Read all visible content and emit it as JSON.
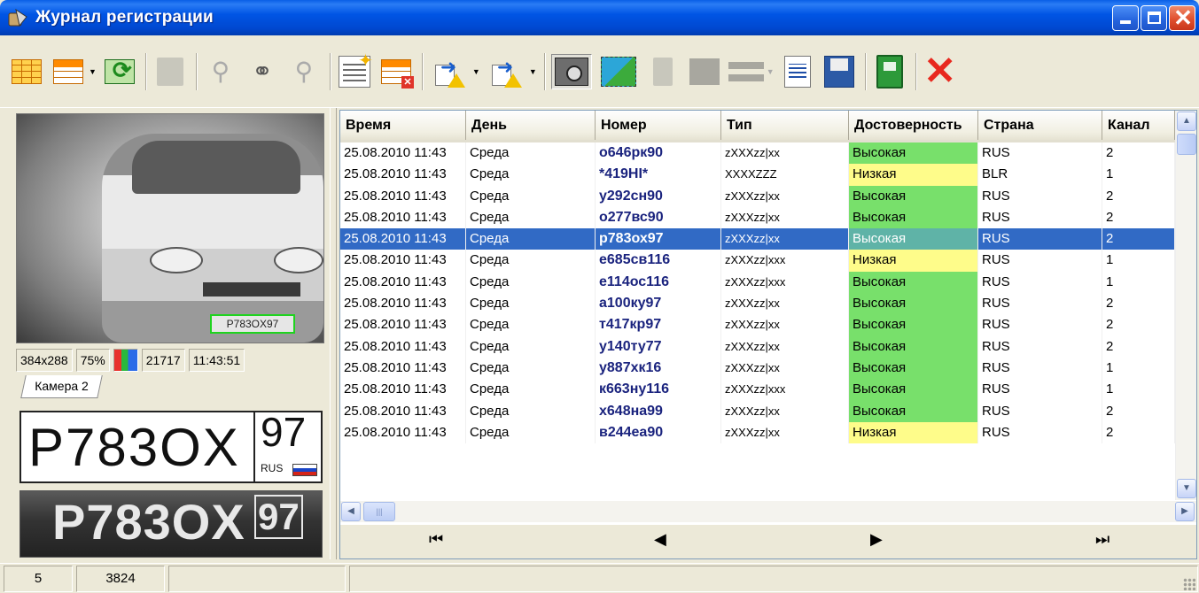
{
  "window": {
    "title": "Журнал регистрации",
    "icons": {
      "app": "app-icon",
      "minimize": "minimize-icon",
      "maximize": "maximize-icon",
      "close": "close-icon"
    }
  },
  "toolbar": {
    "buttons": [
      "table-icon",
      "table-dropdown-icon",
      "refresh-table-icon",
      "flag-icon",
      "binoculars-prev-icon",
      "binoculars-icon",
      "binoculars-next-icon",
      "table-wand-icon",
      "table-delete-icon",
      "export-icon",
      "import-icon",
      "camera-icon",
      "photo-add-icon",
      "sheet-icon",
      "rect-icon",
      "lines-icon",
      "document-icon",
      "save-icon",
      "book-icon",
      "delete-icon"
    ]
  },
  "left_panel": {
    "image_size": "384x288",
    "zoom": "75%",
    "frame": "21717",
    "time": "11:43:51",
    "camera_tab": "Камера 2",
    "plate_main": "P783OX",
    "plate_region": "97",
    "plate_country": "RUS",
    "photo_plate": "P783OX",
    "photo_region": "97",
    "overlay_plate": "P783OX97"
  },
  "grid": {
    "columns": [
      "Время",
      "День",
      "Номер",
      "Тип",
      "Достоверность",
      "Страна",
      "Канал"
    ],
    "rows": [
      {
        "time": "25.08.2010 11:43",
        "day": "Среда",
        "number": "о646рк90",
        "type": "zXXXzz|xx",
        "conf": "Высокая",
        "conf_level": "hi",
        "country": "RUS",
        "channel": "2"
      },
      {
        "time": "25.08.2010 11:43",
        "day": "Среда",
        "number": "*419HI*",
        "type": "XXXXZZZ",
        "conf": "Низкая",
        "conf_level": "lo",
        "country": "BLR",
        "channel": "1"
      },
      {
        "time": "25.08.2010 11:43",
        "day": "Среда",
        "number": "у292сн90",
        "type": "zXXXzz|xx",
        "conf": "Высокая",
        "conf_level": "hi",
        "country": "RUS",
        "channel": "2"
      },
      {
        "time": "25.08.2010 11:43",
        "day": "Среда",
        "number": "о277вс90",
        "type": "zXXXzz|xx",
        "conf": "Высокая",
        "conf_level": "hi",
        "country": "RUS",
        "channel": "2"
      },
      {
        "time": "25.08.2010 11:43",
        "day": "Среда",
        "number": "р783ох97",
        "type": "zXXXzz|xx",
        "conf": "Высокая",
        "conf_level": "hi",
        "country": "RUS",
        "channel": "2",
        "selected": true
      },
      {
        "time": "25.08.2010 11:43",
        "day": "Среда",
        "number": "е685св116",
        "type": "zXXXzz|xxx",
        "conf": "Низкая",
        "conf_level": "lo",
        "country": "RUS",
        "channel": "1"
      },
      {
        "time": "25.08.2010 11:43",
        "day": "Среда",
        "number": "е114ос116",
        "type": "zXXXzz|xxx",
        "conf": "Высокая",
        "conf_level": "hi",
        "country": "RUS",
        "channel": "1"
      },
      {
        "time": "25.08.2010 11:43",
        "day": "Среда",
        "number": "а100ку97",
        "type": "zXXXzz|xx",
        "conf": "Высокая",
        "conf_level": "hi",
        "country": "RUS",
        "channel": "2"
      },
      {
        "time": "25.08.2010 11:43",
        "day": "Среда",
        "number": "т417кр97",
        "type": "zXXXzz|xx",
        "conf": "Высокая",
        "conf_level": "hi",
        "country": "RUS",
        "channel": "2"
      },
      {
        "time": "25.08.2010 11:43",
        "day": "Среда",
        "number": "у140ту77",
        "type": "zXXXzz|xx",
        "conf": "Высокая",
        "conf_level": "hi",
        "country": "RUS",
        "channel": "2"
      },
      {
        "time": "25.08.2010 11:43",
        "day": "Среда",
        "number": "у887хк16",
        "type": "zXXXzz|xx",
        "conf": "Высокая",
        "conf_level": "hi",
        "country": "RUS",
        "channel": "1"
      },
      {
        "time": "25.08.2010 11:43",
        "day": "Среда",
        "number": "к663ну116",
        "type": "zXXXzz|xxx",
        "conf": "Высокая",
        "conf_level": "hi",
        "country": "RUS",
        "channel": "1"
      },
      {
        "time": "25.08.2010 11:43",
        "day": "Среда",
        "number": "х648на99",
        "type": "zXXXzz|xx",
        "conf": "Высокая",
        "conf_level": "hi",
        "country": "RUS",
        "channel": "2"
      },
      {
        "time": "25.08.2010 11:43",
        "day": "Среда",
        "number": "в244еа90",
        "type": "zXXXzz|xx",
        "conf": "Низкая",
        "conf_level": "lo",
        "country": "RUS",
        "channel": "2"
      }
    ],
    "colors": {
      "high": "#78e06b",
      "low": "#fefc8a",
      "selection": "#316ac5"
    },
    "nav": {
      "first": "⏮",
      "prev": "◀",
      "next": "▶",
      "last": "⏭"
    }
  },
  "status": {
    "cell1": "5",
    "cell2": "3824"
  }
}
